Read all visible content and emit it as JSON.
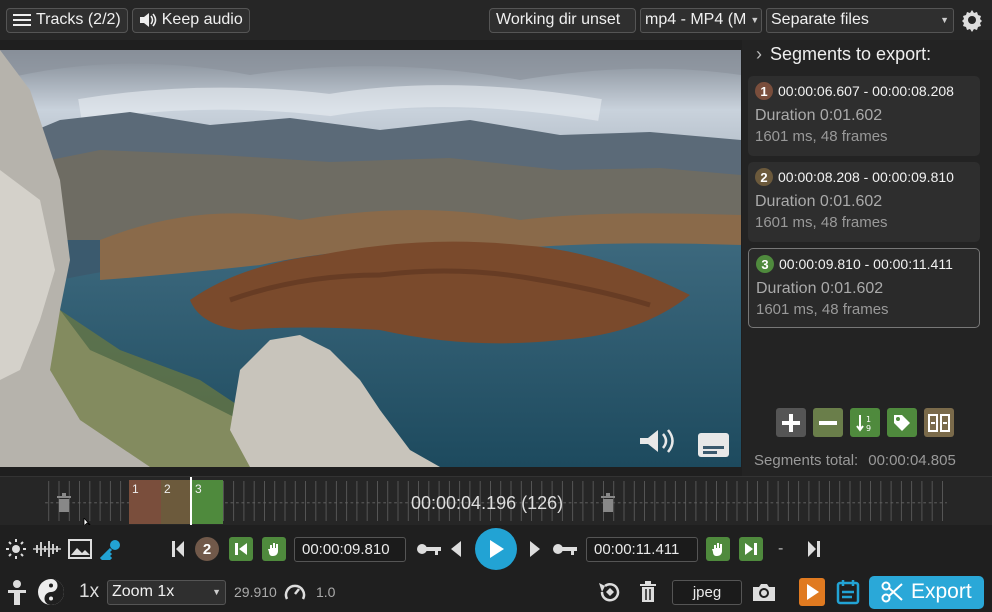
{
  "topbar": {
    "tracks_label": "Tracks (2/2)",
    "keep_audio_label": "Keep audio",
    "working_dir_label": "Working dir unset",
    "format_value": "mp4 - MP4 (M",
    "output_mode_value": "Separate files"
  },
  "segments_panel": {
    "title": "Segments to export:",
    "segments": [
      {
        "number": "1",
        "range": "00:00:06.607 - 00:00:08.208",
        "duration": "Duration 0:01.602",
        "frames": "1601 ms, 48 frames",
        "color": "#7a4e3c"
      },
      {
        "number": "2",
        "range": "00:00:08.208 - 00:00:09.810",
        "duration": "Duration 0:01.602",
        "frames": "1601 ms, 48 frames",
        "color": "#6c5a3c"
      },
      {
        "number": "3",
        "range": "00:00:09.810 - 00:00:11.411",
        "duration": "Duration 0:01.602",
        "frames": "1601 ms, 48 frames",
        "color": "#4f8a3d"
      }
    ],
    "totals_label": "Segments total:",
    "totals_value": "00:00:04.805"
  },
  "timeline": {
    "timecode": "00:00:04.196 (126)",
    "segment_labels": [
      "1",
      "2",
      "3"
    ]
  },
  "controls": {
    "segment_number": "2",
    "cut_start": "00:00:09.810",
    "cut_end": "00:00:11.411",
    "dash": "-",
    "speed": "1x",
    "zoom_value": "Zoom 1x",
    "fps": "29.910",
    "playback_rate": "1.0",
    "capture_format": "jpeg",
    "export_label": "Export"
  },
  "colors": {
    "accent": "#2aa8d8",
    "seg1": "#7a4e3c",
    "seg2": "#6c5a3c",
    "seg3": "#4f8a3d"
  }
}
